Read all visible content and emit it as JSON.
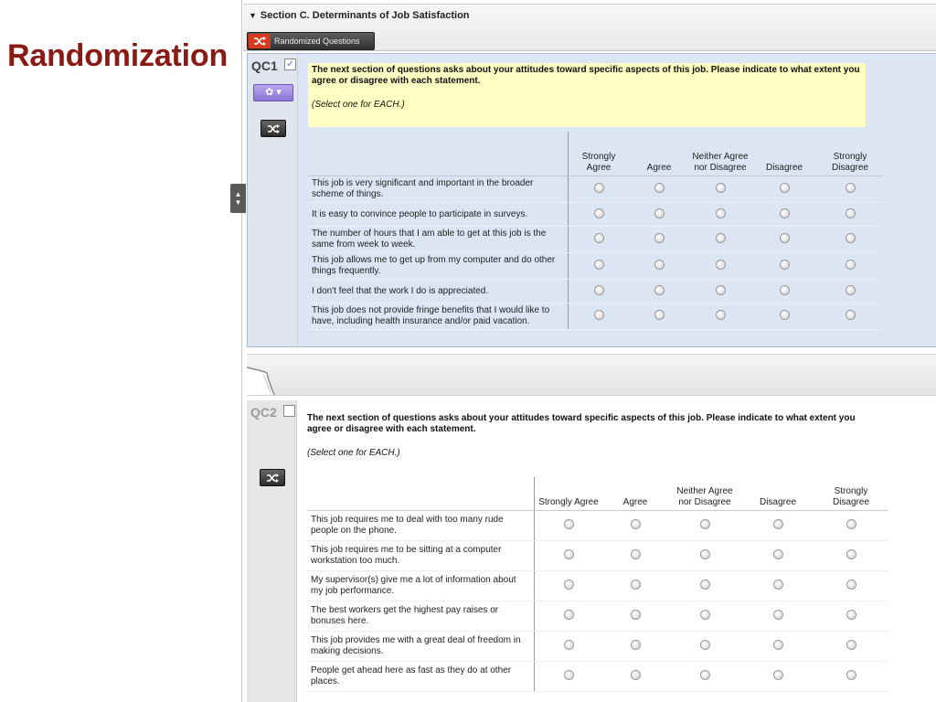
{
  "slide": {
    "title": "Randomization"
  },
  "section": {
    "title": "Section C. Determinants of Job Satisfaction",
    "toggle_icon": "triangle-down",
    "randomize_label": "Randomized Questions",
    "randomize_icon": "shuffle-icon",
    "accent_color": "#d93a1f"
  },
  "questions": [
    {
      "id": "QC1",
      "checked": true,
      "checkbox_mark": "✓",
      "selected": true,
      "text": "The next section of questions asks about your attitudes toward specific aspects of this job. Please indicate to what extent you agree or disagree with each statement.",
      "instruction": "(Select one for EACH.)",
      "columns": [
        "Strongly Agree",
        "Agree",
        "Neither Agree nor Disagree",
        "Disagree",
        "Strongly Disagree"
      ],
      "rows": [
        "This job is very significant and important in the broader scheme of things.",
        "It is easy to convince people to participate in surveys.",
        "The number of hours that I am able to get at this job is the same from week to week.",
        "This job allows me to get up from my computer and do other things frequently.",
        "I don't feel that the work I do is appreciated.",
        "This job does not provide fringe benefits that I would like to have, including health insurance and/or paid vacation."
      ]
    },
    {
      "id": "QC2",
      "checked": false,
      "checkbox_mark": "",
      "selected": false,
      "text": "The next section of questions asks about your attitudes toward specific aspects of this job. Please indicate to what extent you agree or disagree with each statement.",
      "instruction": "(Select one for EACH.)",
      "columns": [
        "Strongly Agree",
        "Agree",
        "Neither Agree nor Disagree",
        "Disagree",
        "Strongly Disagree"
      ],
      "rows": [
        "This job requires me to deal with too many rude people on the phone.",
        "This job requires me to be sitting at a computer workstation too much.",
        "My supervisor(s) give me a lot of information about my job performance.",
        "The best workers get the highest pay raises or bonuses here.",
        "This job provides me with a great deal of freedom in making decisions.",
        "People get ahead here as fast as they do at other places."
      ]
    }
  ],
  "icons": {
    "gear": "gear-icon",
    "dropdown": "chevron-down-icon",
    "shuffle": "shuffle-icon",
    "move": "move-up-down-icon",
    "page_break": "page-break-icon"
  }
}
